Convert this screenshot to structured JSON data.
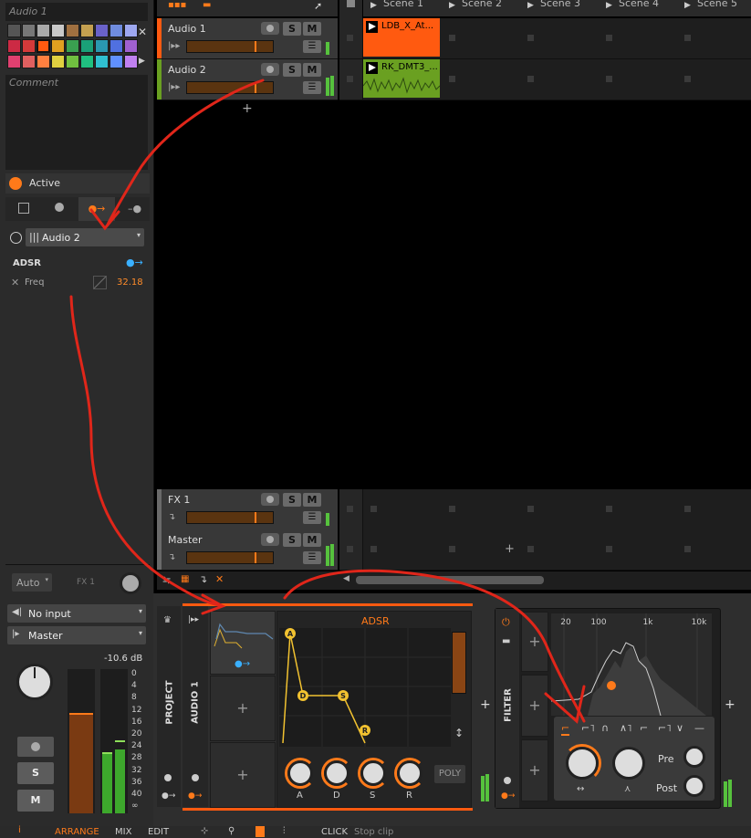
{
  "inspector": {
    "track_name": "Audio 1",
    "comment_label": "Comment",
    "palette_colors": [
      "#555555",
      "#777777",
      "#aaaaaa",
      "#c9c9c9",
      "#a07040",
      "#c4a050",
      "#6a62c9",
      "#6f8cde",
      "#9ea8f0",
      "#cc2a44",
      "#d33a3a",
      "#ff5a10",
      "#e0a020",
      "#3aa050",
      "#1aa078",
      "#2a98b0",
      "#5070e0",
      "#a060d0",
      "#e04070",
      "#e06060",
      "#ff8040",
      "#e0d040",
      "#70c040",
      "#20c080",
      "#30c0d0",
      "#6090ff",
      "#c080f0"
    ],
    "active_label": "Active",
    "modulator_target": "Audio 2",
    "modulator_name": "ADSR",
    "param_name": "Freq",
    "param_value": "32.18",
    "auto_label": "Auto",
    "fx_label": "FX 1",
    "input_label": "No input",
    "output_label": "Master",
    "db_value": "-10.6 dB",
    "meter_scale": [
      "0",
      "4",
      "8",
      "12",
      "16",
      "20",
      "24",
      "28",
      "32",
      "36",
      "40",
      "∞"
    ],
    "solo": "S",
    "mute": "M"
  },
  "tracks": [
    {
      "name": "Audio 1",
      "color": "#ff5a10",
      "s": "S",
      "m": "M"
    },
    {
      "name": "Audio 2",
      "color": "#6aa021",
      "s": "S",
      "m": "M"
    },
    {
      "name": "FX 1",
      "color": "#6a6a6a",
      "s": "S",
      "m": "M"
    },
    {
      "name": "Master",
      "color": "#6a6a6a",
      "s": "S",
      "m": "M"
    }
  ],
  "scenes": [
    "Scene 1",
    "Scene 2",
    "Scene 3",
    "Scene 4",
    "Scene 5"
  ],
  "clips": [
    {
      "name": "LDB_X_At...",
      "color": "#ff5a10"
    },
    {
      "name": "RK_DMT3_...",
      "color": "#6aa021"
    }
  ],
  "devices": {
    "project_label": "PROJECT",
    "track_label": "AUDIO 1",
    "adsr_title": "ADSR",
    "adsr_points": [
      "A",
      "D",
      "S",
      "R"
    ],
    "adsr_knobs": [
      "A",
      "D",
      "S",
      "R"
    ],
    "poly_label": "POLY",
    "filter_label": "FILTER",
    "freq_ticks": [
      "20",
      "100",
      "1k",
      "10k"
    ],
    "pre_label": "Pre",
    "post_label": "Post"
  },
  "statusbar": {
    "tabs": [
      "ARRANGE",
      "MIX",
      "EDIT"
    ],
    "click_label": "CLICK",
    "hint": "Stop clip"
  }
}
